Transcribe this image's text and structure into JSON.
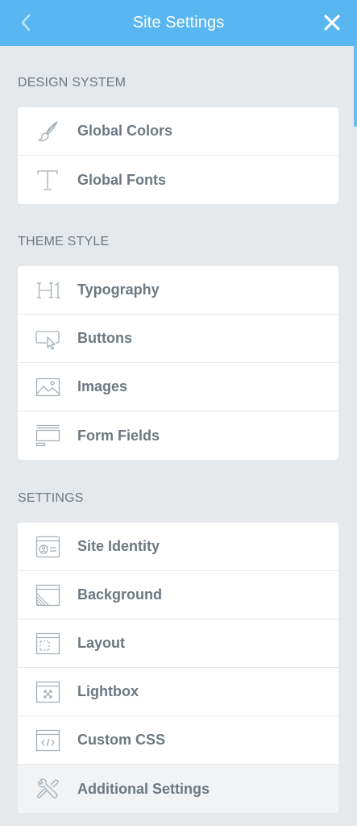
{
  "header": {
    "title": "Site Settings",
    "bg_color": "#58b6f0",
    "back_icon": "chevron-left-icon",
    "close_icon": "close-icon"
  },
  "sections": {
    "design_system": {
      "title": "DESIGN SYSTEM",
      "items": [
        {
          "label": "Global Colors",
          "icon": "brush-icon"
        },
        {
          "label": "Global Fonts",
          "icon": "typeface-icon"
        }
      ]
    },
    "theme_style": {
      "title": "THEME STYLE",
      "items": [
        {
          "label": "Typography",
          "icon": "heading-icon"
        },
        {
          "label": "Buttons",
          "icon": "button-cursor-icon"
        },
        {
          "label": "Images",
          "icon": "image-icon"
        },
        {
          "label": "Form Fields",
          "icon": "form-fields-icon"
        }
      ]
    },
    "settings": {
      "title": "SETTINGS",
      "items": [
        {
          "label": "Site Identity",
          "icon": "site-identity-icon"
        },
        {
          "label": "Background",
          "icon": "background-icon"
        },
        {
          "label": "Layout",
          "icon": "layout-icon"
        },
        {
          "label": "Lightbox",
          "icon": "lightbox-icon"
        },
        {
          "label": "Custom CSS",
          "icon": "code-icon"
        },
        {
          "label": "Additional Settings",
          "icon": "tools-icon"
        }
      ]
    }
  },
  "colors": {
    "text": "#6d7882",
    "icon": "#a4afb7",
    "background": "#e6e9ec",
    "card": "#ffffff"
  }
}
